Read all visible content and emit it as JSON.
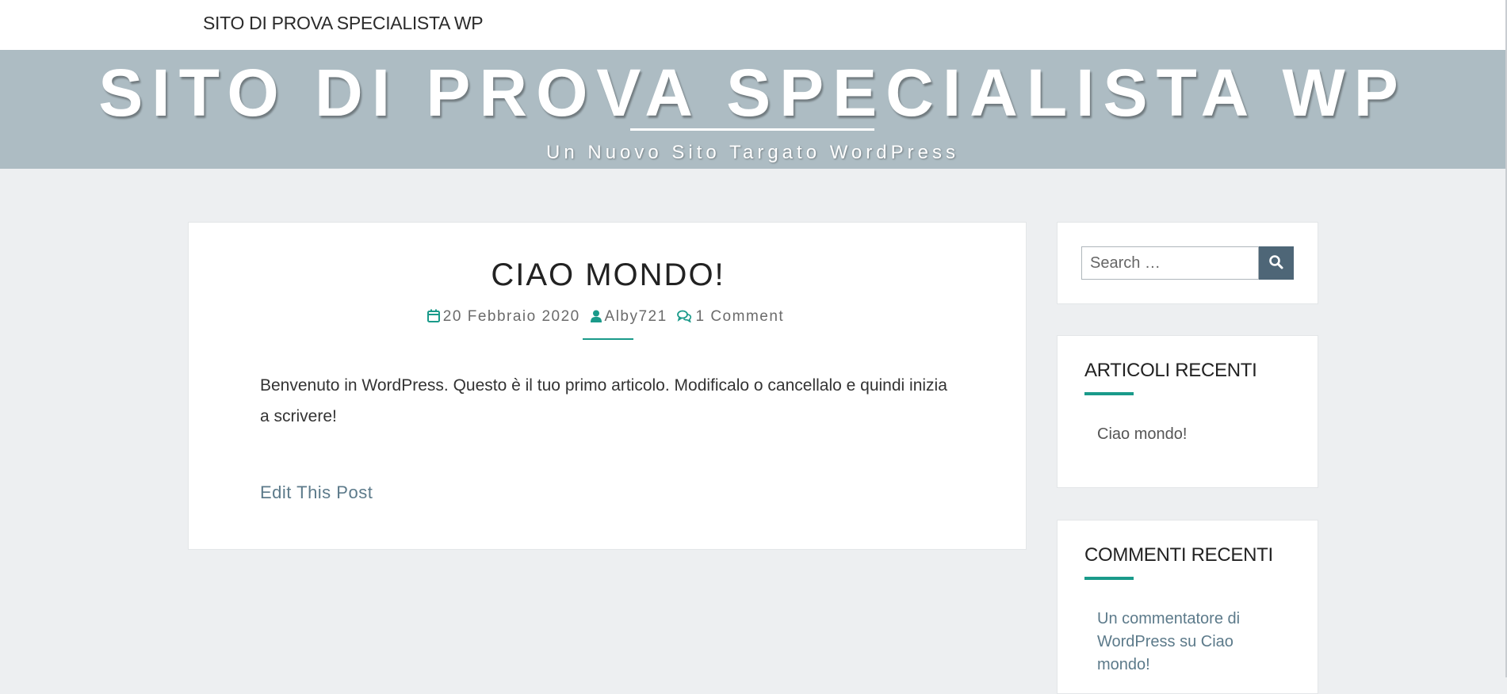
{
  "topbar": {
    "site_link": "SITO DI PROVA SPECIALISTA WP"
  },
  "hero": {
    "title": "SITO DI PROVA SPECIALISTA WP",
    "tagline": "Un Nuovo Sito Targato WordPress"
  },
  "post": {
    "title": "CIAO MONDO!",
    "date": "20 Febbraio 2020",
    "author": "Alby721",
    "comments": "1 Comment",
    "content": "Benvenuto in WordPress. Questo è il tuo primo articolo. Modificalo o cancellalo e quindi inizia a scrivere!",
    "edit_link": "Edit This Post"
  },
  "sidebar": {
    "search": {
      "placeholder": "Search …"
    },
    "recent_posts": {
      "title": "ARTICOLI RECENTI",
      "items": [
        "Ciao mondo!"
      ]
    },
    "recent_comments": {
      "title": "COMMENTI RECENTI",
      "items": [
        "Un commentatore di WordPress su Ciao mondo!"
      ]
    }
  },
  "colors": {
    "accent": "#1a9a8a",
    "hero_bg": "#adbcc3",
    "page_bg": "#edeff1",
    "search_button": "#4e6677",
    "link": "#5c7a8a"
  },
  "icons": {
    "date": "calendar-icon",
    "author": "user-icon",
    "comments": "comments-icon",
    "search": "search-icon"
  }
}
